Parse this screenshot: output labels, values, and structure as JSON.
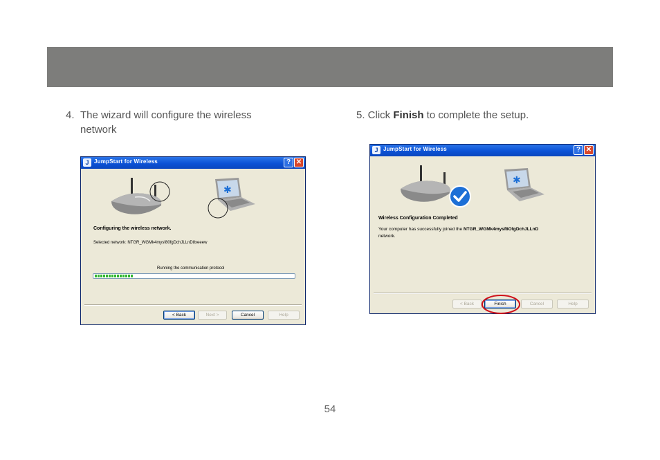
{
  "page": {
    "number": "54"
  },
  "steps": {
    "step4": {
      "number": "4.",
      "text": "The wizard will configure the wireless network"
    },
    "step5": {
      "prefix": "5. Click ",
      "bold": "Finish",
      "suffix": " to complete the setup."
    }
  },
  "dialog_left": {
    "title": "JumpStart for Wireless",
    "heading": "Configuring the wireless network.",
    "selected_network": "Selected network: NTGR_WGMk4mysf80fgDchJLLnD8xeeew",
    "status": "Running the communication protocol",
    "progress_percent": 20,
    "buttons": {
      "back": "< Back",
      "next": "Next >",
      "cancel": "Cancel",
      "help": "Help"
    }
  },
  "dialog_right": {
    "title": "JumpStart for Wireless",
    "heading": "Wireless Configuration Completed",
    "message_prefix": "Your computer has successfully joined the ",
    "network": "NTGR_WGMk4mysf8OfgDchJLLnD",
    "message_suffix": "network.",
    "buttons": {
      "back": "< Back",
      "finish": "Finish",
      "cancel": "Cancel",
      "help": "Help"
    }
  },
  "colors": {
    "banner": "#7d7d7b",
    "titlebar": "#0b52d6",
    "progress": "#2fb62f",
    "highlight": "#d0101a",
    "check": "#1c6fd6"
  }
}
